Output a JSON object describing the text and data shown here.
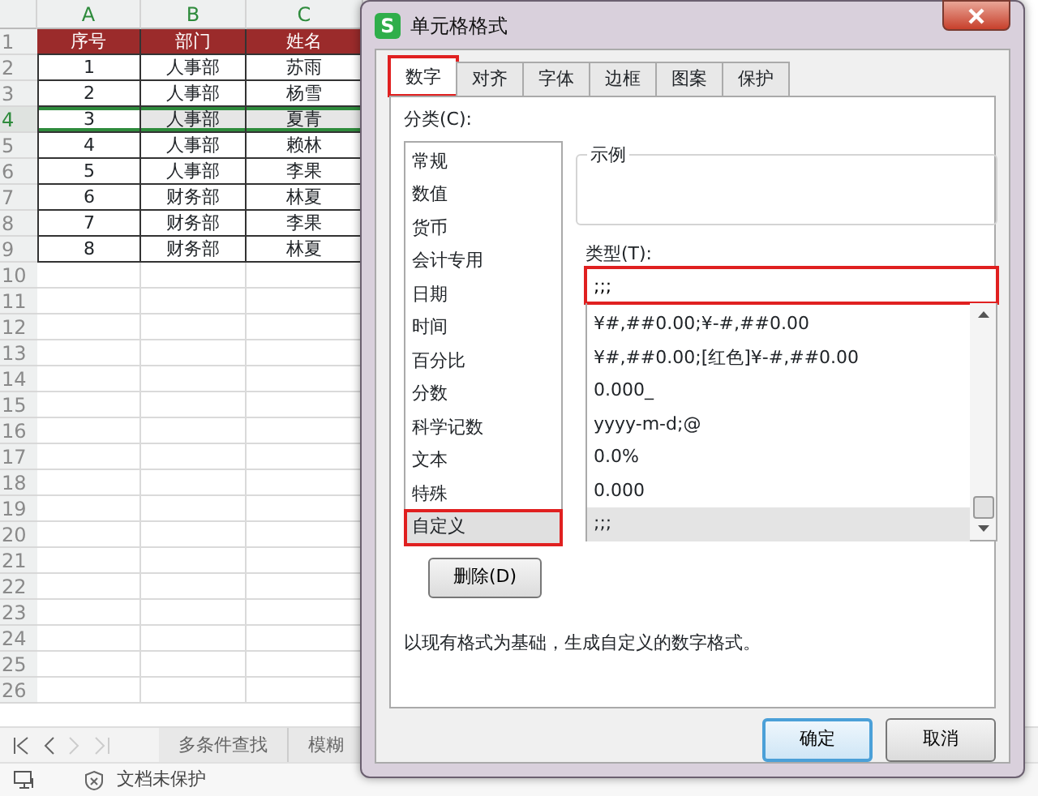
{
  "sheet": {
    "columns": [
      "A",
      "B",
      "C"
    ],
    "rows": [
      {
        "number": "1",
        "kind": "header",
        "selected": false,
        "cells": [
          "序号",
          "部门",
          "姓名"
        ]
      },
      {
        "number": "2",
        "kind": "data",
        "selected": false,
        "cells": [
          "1",
          "人事部",
          "苏雨"
        ]
      },
      {
        "number": "3",
        "kind": "data",
        "selected": false,
        "cells": [
          "2",
          "人事部",
          "杨雪"
        ]
      },
      {
        "number": "4",
        "kind": "data",
        "selected": true,
        "cells": [
          "3",
          "人事部",
          "夏青"
        ]
      },
      {
        "number": "5",
        "kind": "data",
        "selected": false,
        "cells": [
          "4",
          "人事部",
          "赖林"
        ]
      },
      {
        "number": "6",
        "kind": "data",
        "selected": false,
        "cells": [
          "5",
          "人事部",
          "李果"
        ]
      },
      {
        "number": "7",
        "kind": "data",
        "selected": false,
        "cells": [
          "6",
          "财务部",
          "林夏"
        ]
      },
      {
        "number": "8",
        "kind": "data",
        "selected": false,
        "cells": [
          "7",
          "财务部",
          "李果"
        ]
      },
      {
        "number": "9",
        "kind": "data",
        "selected": false,
        "cells": [
          "8",
          "财务部",
          "林夏"
        ]
      },
      {
        "number": "10",
        "kind": "empty",
        "selected": false,
        "cells": []
      },
      {
        "number": "11",
        "kind": "empty",
        "selected": false,
        "cells": []
      },
      {
        "number": "12",
        "kind": "empty",
        "selected": false,
        "cells": []
      },
      {
        "number": "13",
        "kind": "empty",
        "selected": false,
        "cells": []
      },
      {
        "number": "14",
        "kind": "empty",
        "selected": false,
        "cells": []
      },
      {
        "number": "15",
        "kind": "empty",
        "selected": false,
        "cells": []
      },
      {
        "number": "16",
        "kind": "empty",
        "selected": false,
        "cells": []
      },
      {
        "number": "17",
        "kind": "empty",
        "selected": false,
        "cells": []
      },
      {
        "number": "18",
        "kind": "empty",
        "selected": false,
        "cells": []
      },
      {
        "number": "19",
        "kind": "empty",
        "selected": false,
        "cells": []
      },
      {
        "number": "20",
        "kind": "empty",
        "selected": false,
        "cells": []
      },
      {
        "number": "21",
        "kind": "empty",
        "selected": false,
        "cells": []
      },
      {
        "number": "22",
        "kind": "empty",
        "selected": false,
        "cells": []
      },
      {
        "number": "23",
        "kind": "empty",
        "selected": false,
        "cells": []
      },
      {
        "number": "24",
        "kind": "empty",
        "selected": false,
        "cells": []
      },
      {
        "number": "25",
        "kind": "empty",
        "selected": false,
        "cells": []
      },
      {
        "number": "26",
        "kind": "empty",
        "selected": false,
        "cells": []
      }
    ]
  },
  "sheet_tabs": [
    {
      "label": "多条件查找",
      "selected": false
    },
    {
      "label": "模糊",
      "selected": false
    }
  ],
  "status_bar": {
    "protection": "文档未保护"
  },
  "dialog": {
    "app_logo": "S",
    "title": "单元格格式",
    "tabs": [
      {
        "label": "数字",
        "selected": true,
        "highlighted": true
      },
      {
        "label": "对齐",
        "selected": false,
        "highlighted": false
      },
      {
        "label": "字体",
        "selected": false,
        "highlighted": false
      },
      {
        "label": "边框",
        "selected": false,
        "highlighted": false
      },
      {
        "label": "图案",
        "selected": false,
        "highlighted": false
      },
      {
        "label": "保护",
        "selected": false,
        "highlighted": false
      }
    ],
    "category_label": "分类(C):",
    "categories": [
      {
        "label": "常规",
        "selected": false,
        "highlighted": false
      },
      {
        "label": "数值",
        "selected": false,
        "highlighted": false
      },
      {
        "label": "货币",
        "selected": false,
        "highlighted": false
      },
      {
        "label": "会计专用",
        "selected": false,
        "highlighted": false
      },
      {
        "label": "日期",
        "selected": false,
        "highlighted": false
      },
      {
        "label": "时间",
        "selected": false,
        "highlighted": false
      },
      {
        "label": "百分比",
        "selected": false,
        "highlighted": false
      },
      {
        "label": "分数",
        "selected": false,
        "highlighted": false
      },
      {
        "label": "科学记数",
        "selected": false,
        "highlighted": false
      },
      {
        "label": "文本",
        "selected": false,
        "highlighted": false
      },
      {
        "label": "特殊",
        "selected": false,
        "highlighted": false
      },
      {
        "label": "自定义",
        "selected": true,
        "highlighted": true
      }
    ],
    "sample_label": "示例",
    "type_label": "类型(T):",
    "type_field": {
      "value": ";;;",
      "highlighted": true
    },
    "formats": [
      {
        "label": "¥#,##0.00;¥-#,##0.00",
        "selected": false
      },
      {
        "label": "¥#,##0.00;[红色]¥-#,##0.00",
        "selected": false
      },
      {
        "label": "0.000_",
        "selected": false
      },
      {
        "label": "yyyy-m-d;@",
        "selected": false
      },
      {
        "label": "0.0%",
        "selected": false
      },
      {
        "label": "0.000",
        "selected": false
      },
      {
        "label": ";;;",
        "selected": true
      }
    ],
    "delete_button": "删除(D)",
    "description": "以现有格式为基础，生成自定义的数字格式。",
    "buttons": [
      {
        "label": "确定",
        "kind": "default"
      },
      {
        "label": "取消",
        "kind": "normal"
      }
    ]
  }
}
